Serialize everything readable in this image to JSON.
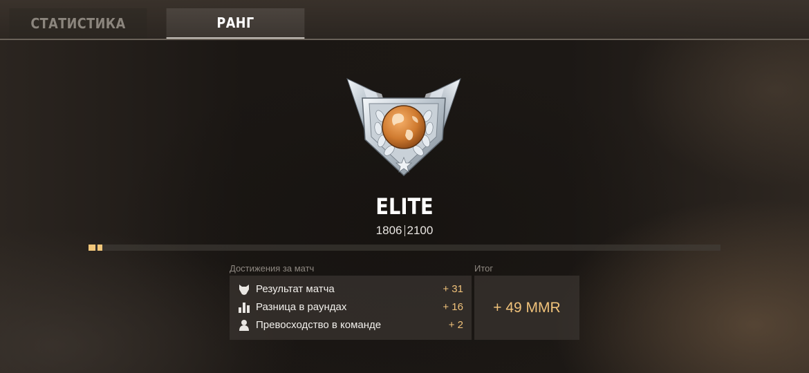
{
  "tabs": {
    "stats_label": "СТАТИСТИКА",
    "rank_label": "РАНГ"
  },
  "rank": {
    "name": "ELITE",
    "current_points": "1806",
    "next_points": "2100",
    "progress_fraction": 0.017
  },
  "achievements": {
    "header": "Достижения за матч",
    "items": [
      {
        "icon": "wolf-head-icon",
        "label": "Результат матча",
        "value": "+ 31"
      },
      {
        "icon": "bar-chart-icon",
        "label": "Разница в раундах",
        "value": "+ 16"
      },
      {
        "icon": "person-icon",
        "label": "Превосходство в команде",
        "value": "+ 2"
      }
    ]
  },
  "total": {
    "header": "Итог",
    "value": "+ 49 MMR"
  },
  "colors": {
    "accent": "#f0c27a",
    "progress": "#f1c67a",
    "text": "#f2f0ec"
  }
}
